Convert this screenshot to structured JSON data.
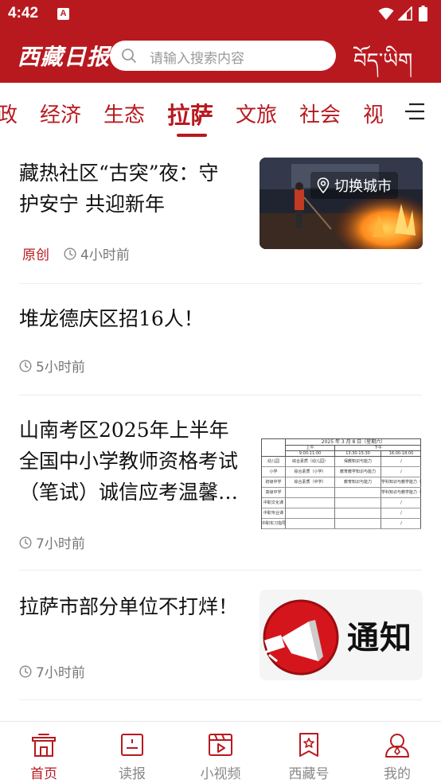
{
  "status": {
    "time": "4:42",
    "notif_letter": "A"
  },
  "header": {
    "logo": "西藏日报",
    "search_placeholder": "请输入搜索内容",
    "tibetan_text": "བོད་ཡིག"
  },
  "tabs": [
    "政",
    "经济",
    "生态",
    "拉萨",
    "文旅",
    "社会",
    "视"
  ],
  "active_tab": "拉萨",
  "news": [
    {
      "title_lines": [
        "藏热社区“古突”夜：守",
        "护安宁  共迎新年"
      ],
      "badge": "原创",
      "time": "4小时前",
      "thumb_overlay": "切换城市"
    },
    {
      "title_lines": [
        "堆龙德庆区招16人！"
      ],
      "time": "5小时前"
    },
    {
      "title_lines": [
        "山南考区2025年上半年",
        "全国中小学教师资格考试",
        "（笔试）诚信应考温馨…"
      ],
      "time": "7小时前",
      "thumb_table": {
        "header_date": "2025 年 3 月 8 日（星期六）",
        "col_labels": [
          "上午",
          "下午"
        ],
        "col_times": [
          "9:00-11:00",
          "13:30-15:30",
          "16:00-18:00"
        ],
        "rows": [
          [
            "幼儿园",
            "综合素质（幼儿园）",
            "保教知识与能力",
            "/"
          ],
          [
            "小学",
            "综合素质（小学）",
            "教育教学知识与能力",
            "/"
          ],
          [
            "初级中学",
            "综合素质（中学）",
            "教育知识与能力",
            "学科知识与教学能力（初级中学）"
          ],
          [
            "高级中学",
            "",
            "",
            "学科知识与教学能力（高级中学）"
          ],
          [
            "中职文化课",
            "",
            "",
            "/"
          ],
          [
            "中职专业课",
            "",
            "",
            "/"
          ],
          [
            "中职实习指导",
            "",
            "",
            "/"
          ]
        ]
      }
    },
    {
      "title_lines": [
        "拉萨市部分单位不打烊！"
      ],
      "time": "7小时前",
      "thumb_text": "通知"
    }
  ],
  "bottom_nav": [
    {
      "label": "首页",
      "icon": "home-icon",
      "active": true
    },
    {
      "label": "读报",
      "icon": "newspaper-icon",
      "active": false
    },
    {
      "label": "小视频",
      "icon": "video-icon",
      "active": false
    },
    {
      "label": "西藏号",
      "icon": "bookmark-icon",
      "active": false
    },
    {
      "label": "我的",
      "icon": "user-icon",
      "active": false
    }
  ],
  "colors": {
    "brand_red": "#b8191f",
    "meta_gray": "#777777"
  }
}
